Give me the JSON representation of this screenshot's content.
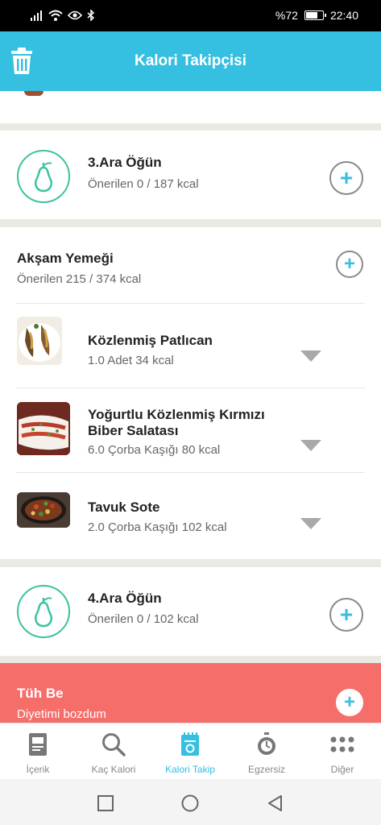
{
  "status_bar": {
    "battery_text": "%72",
    "time": "22:40",
    "battery_level": 0.72,
    "icons": [
      "signal-icon",
      "wifi-icon",
      "eye-icon",
      "bluetooth-icon",
      "battery-icon"
    ]
  },
  "header": {
    "title": "Kalori Takipçisi",
    "trash_icon": "trash-icon"
  },
  "colors": {
    "accent": "#35bfe0",
    "green": "#3cc3a0",
    "red_card": "#f66e6a",
    "gray_bg": "#ebe9e4"
  },
  "meals": {
    "snack3": {
      "title": "3.Ara Öğün",
      "subtitle": "Önerilen 0 / 187 kcal",
      "icon": "pear-icon"
    },
    "dinner": {
      "title": "Akşam Yemeği",
      "subtitle": "Önerilen 215 / 374 kcal",
      "foods": [
        {
          "name": "Közlenmiş Patlıcan",
          "info": "1.0 Adet 34 kcal"
        },
        {
          "name_line1": "Yoğurtlu Közlenmiş Kırmızı",
          "name_line2": "Biber Salatası",
          "info": "6.0 Çorba Kaşığı 80 kcal"
        },
        {
          "name": "Tavuk Sote",
          "info": "2.0 Çorba Kaşığı 102 kcal"
        }
      ]
    },
    "snack4": {
      "title": "4.Ara Öğün",
      "subtitle": "Önerilen 0 / 102 kcal",
      "icon": "pear-icon"
    },
    "cheat": {
      "title": "Tüh Be",
      "subtitle": "Diyetimi bozdum"
    }
  },
  "bottom_nav": {
    "items": [
      {
        "label": "İçerik",
        "icon": "document-icon"
      },
      {
        "label": "Kaç Kalori",
        "icon": "search-icon"
      },
      {
        "label": "Kalori Takip",
        "icon": "notepad-icon"
      },
      {
        "label": "Egzersiz",
        "icon": "stopwatch-icon"
      },
      {
        "label": "Diğer",
        "icon": "grid-dots-icon"
      }
    ],
    "active_index": 2
  },
  "system_nav": [
    "square-icon",
    "circle-icon",
    "back-triangle-icon"
  ]
}
